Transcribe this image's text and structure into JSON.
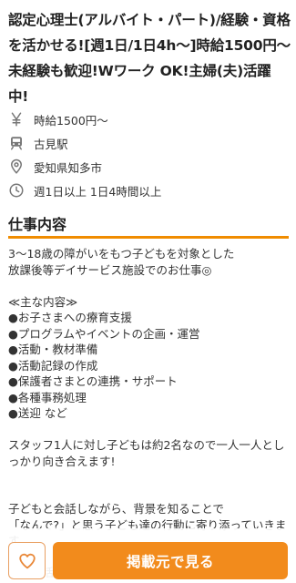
{
  "job": {
    "title": "認定心理士(アルバイト・パート)/経験・資格を活かせる![週1日/1日4h〜]時給1500円〜未経験も歓迎!Wワーク OK!主婦(夫)活躍中!"
  },
  "info": {
    "wage": {
      "icon": "yen-icon",
      "text": "時給1500円〜"
    },
    "station": {
      "icon": "train-icon",
      "text": "古見駅"
    },
    "location": {
      "icon": "map-pin-icon",
      "text": "愛知県知多市"
    },
    "schedule": {
      "icon": "clock-icon",
      "text": "週1日以上 1日4時間以上"
    }
  },
  "section": {
    "heading": "仕事内容"
  },
  "description": {
    "text": "3〜18歳の障がいをもつ子どもを対象とした\n放課後等デイサービス施設でのお仕事◎\n\n≪主な内容≫\n●お子さまへの療育支援\n●プログラムやイベントの企画・運営\n●活動・教材準備\n●活動記録の作成\n●保護者さまとの連携・サポート\n●各種事務処理\n●送迎 など\n\nスタッフ1人に対し子どもは約2名なので一人一人としっかり向き合えます!\n\n\n子どもと会話しながら、背景を知ることで\n「なんで?」と思う子ども達の行動に寄り添っていきます。\n\n日常生活や遊びなどの活動を通して"
  },
  "actions": {
    "favorite_icon": "heart-icon",
    "cta_label": "掲載元で見る"
  },
  "colors": {
    "accent": "#f28b1c",
    "rule": "#f08c00"
  }
}
